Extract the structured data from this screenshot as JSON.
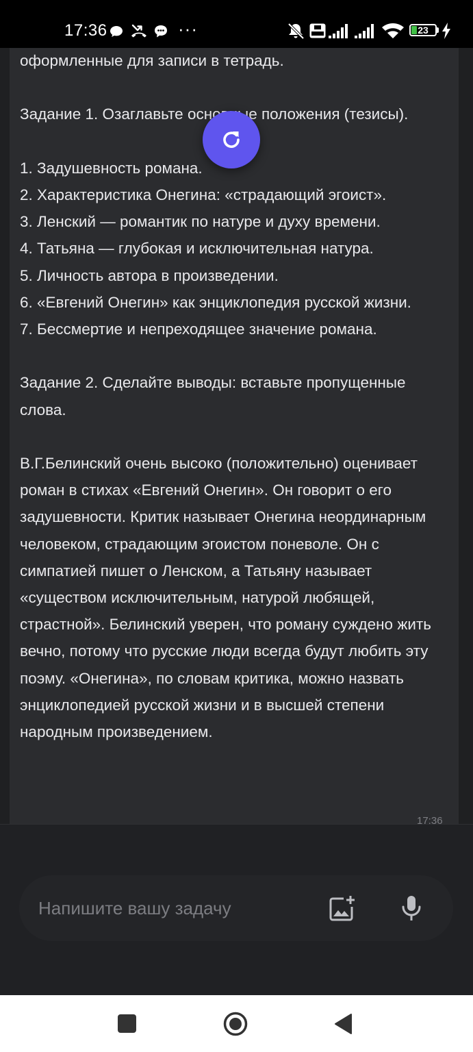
{
  "status_bar": {
    "time": "17:36",
    "more_dots": "···",
    "battery_level": "23",
    "icons": [
      "chat-bubble-icon",
      "missed-call-icon",
      "message-icon",
      "more-dots-icon",
      "mute-icon",
      "volte-icon",
      "signal-icon",
      "signal-icon",
      "wifi-icon",
      "battery-icon",
      "charging-icon"
    ]
  },
  "message": {
    "text": "оформленные для записи в тетрадь.\n\nЗадание 1. Озаглавьте основные положения (тезисы).\n\n1. Задушевность романа.\n2. Характеристика Онегина: «страдающий эгоист».\n3. Ленский — романтик по натуре и духу времени.\n4. Татьяна — глубокая и исключительная натура.\n5. Личность автора в произведении.\n6. «Евгений Онегин» как энциклопедия русской жизни.\n7. Бессмертие и непреходящее значение романа.\n\nЗадание 2. Сделайте выводы: вставьте пропущенные слова.\n\nВ.Г.Белинский очень высоко (положительно) оценивает роман в стихах «Евгений Онегин». Он говорит о его задушевности. Критик называет Онегина неординарным человеком, страдающим эгоистом поневоле. Он с симпатией пишет о Ленском, а Татьяну называет «существом исключительным, натурой любящей, страстной». Белинский уверен, что роману суждено жить вечно, потому что русские люди всегда будут любить эту поэму. «Онегина», по словам критика, можно назвать энциклопедией русской жизни и в высшей степени народным произведением.",
    "time": "17:36"
  },
  "refresh_button": {
    "icon": "refresh-icon"
  },
  "input": {
    "placeholder": "Напишите вашу задачу",
    "value": "",
    "attach_icon": "add-image-icon",
    "mic_icon": "microphone-icon"
  },
  "nav": {
    "recents_icon": "recents-square-icon",
    "home_icon": "home-circle-icon",
    "back_icon": "back-triangle-icon"
  },
  "colors": {
    "background": "#1f2022",
    "bubble": "#2b2c2f",
    "text": "#e9e9ec",
    "accent": "#5f55ee",
    "battery": "#42c047"
  }
}
